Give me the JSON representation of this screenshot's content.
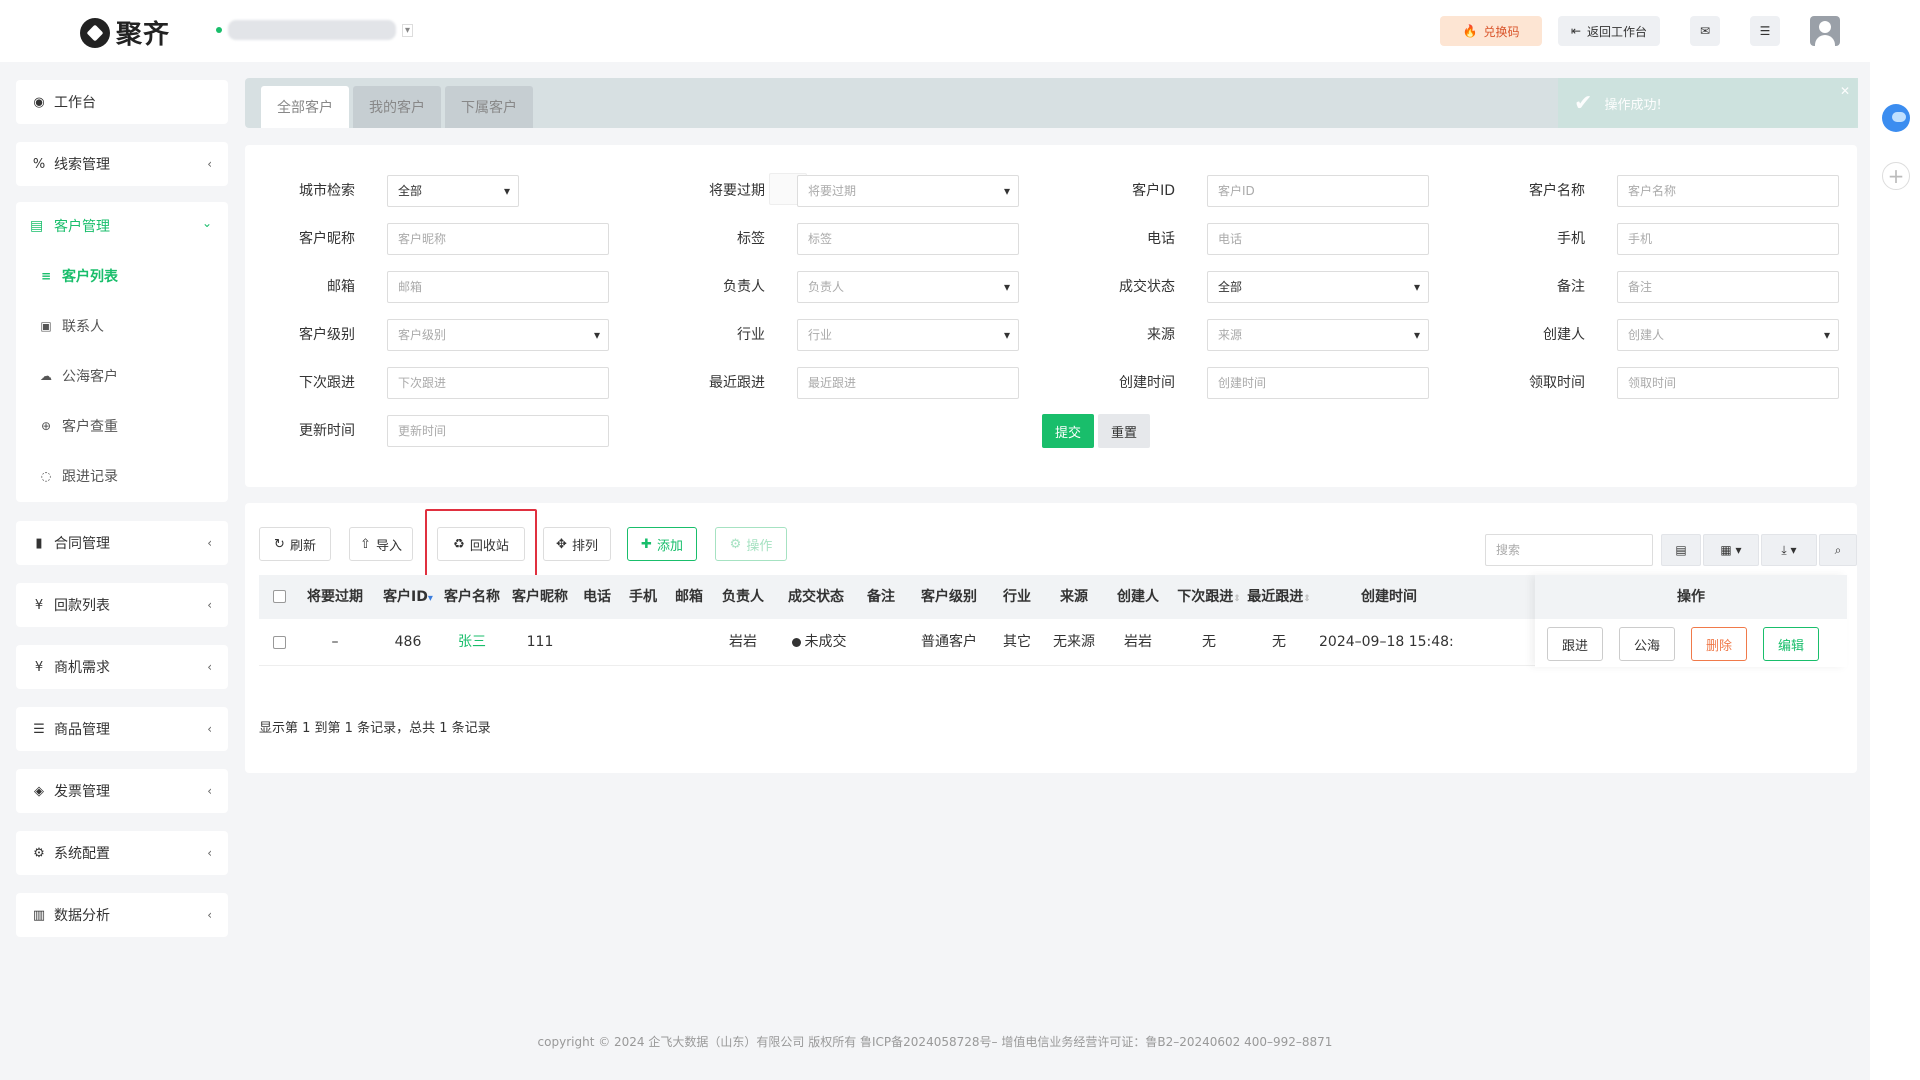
{
  "header": {
    "logo_text": "聚齐",
    "redeem_label": "兑换码",
    "back_label": "返回工作台"
  },
  "sidebar": {
    "workbench": "工作台",
    "leads": "线索管理",
    "customer_mgmt": "客户管理",
    "customer_sub": [
      "客户列表",
      "联系人",
      "公海客户",
      "客户查重",
      "跟进记录"
    ],
    "contracts": "合同管理",
    "payments": "回款列表",
    "opportunities": "商机需求",
    "products": "商品管理",
    "invoices": "发票管理",
    "system": "系统配置",
    "analytics": "数据分析"
  },
  "tabs": [
    "全部客户",
    "我的客户",
    "下属客户"
  ],
  "toast": {
    "text": "操作成功!"
  },
  "filters": {
    "labels": [
      "城市检索",
      "将要过期",
      "客户ID",
      "客户名称",
      "客户昵称",
      "标签",
      "电话",
      "手机",
      "邮箱",
      "负责人",
      "成交状态",
      "备注",
      "客户级别",
      "行业",
      "来源",
      "创建人",
      "下次跟进",
      "最近跟进",
      "创建时间",
      "领取时间",
      "更新时间"
    ],
    "values": [
      "全部",
      "将要过期",
      "客户ID",
      "客户名称",
      "客户昵称",
      "标签",
      "电话",
      "手机",
      "邮箱",
      "负责人",
      "全部",
      "备注",
      "客户级别",
      "行业",
      "来源",
      "创建人",
      "下次跟进",
      "最近跟进",
      "创建时间",
      "领取时间",
      "更新时间"
    ],
    "submit": "提交",
    "reset": "重置"
  },
  "toolbar": {
    "refresh": "刷新",
    "import": "导入",
    "recycle": "回收站",
    "arrange": "排列",
    "add": "添加",
    "operate": "操作",
    "search_placeholder": "搜索"
  },
  "table": {
    "headers": [
      "将要过期",
      "客户ID",
      "客户名称",
      "客户昵称",
      "电话",
      "手机",
      "邮箱",
      "负责人",
      "成交状态",
      "备注",
      "客户级别",
      "行业",
      "来源",
      "创建人",
      "下次跟进",
      "最近跟进",
      "创建时间"
    ],
    "ops_header": "操作",
    "row": {
      "expire": "–",
      "id": "486",
      "name": "张三",
      "nickname": "111",
      "owner": "岩岩",
      "status": "未成交",
      "level": "普通客户",
      "industry": "其它",
      "source": "无来源",
      "creator": "岩岩",
      "next_follow": "无",
      "last_follow": "无",
      "created": "2024–09–18 15:48:"
    },
    "ops": [
      "跟进",
      "公海",
      "删除",
      "编辑"
    ],
    "pager": "显示第 1 到第 1 条记录，总共 1 条记录"
  },
  "footer": "copyright © 2024 企飞大数据（山东）有限公司 版权所有  鲁ICP备2024058728号–  增值电信业务经营许可证：鲁B2–20240602  400–992–8871"
}
